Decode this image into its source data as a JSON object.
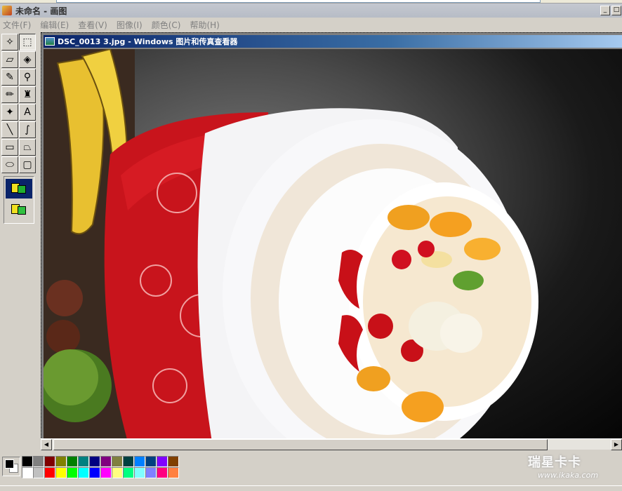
{
  "app": {
    "title": "未命名 - 画图",
    "minimize": "_",
    "maximize": "□"
  },
  "menu": [
    "文件(F)",
    "编辑(E)",
    "查看(V)",
    "图像(I)",
    "颜色(C)",
    "帮助(H)"
  ],
  "tools": [
    {
      "name": "free-form-select-icon",
      "glyph": "✧"
    },
    {
      "name": "select-rect-icon",
      "glyph": "⬚"
    },
    {
      "name": "eraser-icon",
      "glyph": "▱"
    },
    {
      "name": "fill-bucket-icon",
      "glyph": "◈"
    },
    {
      "name": "color-picker-icon",
      "glyph": "✎"
    },
    {
      "name": "magnifier-icon",
      "glyph": "⚲"
    },
    {
      "name": "pencil-icon",
      "glyph": "✏"
    },
    {
      "name": "brush-icon",
      "glyph": "♜"
    },
    {
      "name": "airbrush-icon",
      "glyph": "✦"
    },
    {
      "name": "text-icon",
      "glyph": "A"
    },
    {
      "name": "line-icon",
      "glyph": "╲"
    },
    {
      "name": "curve-icon",
      "glyph": "∫"
    },
    {
      "name": "rectangle-icon",
      "glyph": "▭"
    },
    {
      "name": "polygon-icon",
      "glyph": "⏢"
    },
    {
      "name": "ellipse-icon",
      "glyph": "⬭"
    },
    {
      "name": "rounded-rect-icon",
      "glyph": "▢"
    }
  ],
  "viewer": {
    "title": "DSC_0013 3.jpg - Windows 图片和传真查看器"
  },
  "palette": {
    "foreground": "#000000",
    "background": "#ffffff",
    "colors": [
      "#000000",
      "#808080",
      "#800000",
      "#808000",
      "#008000",
      "#008080",
      "#000080",
      "#800080",
      "#808040",
      "#004040",
      "#0080ff",
      "#004080",
      "#8000ff",
      "#804000",
      "#ffffff",
      "#c0c0c0",
      "#ff0000",
      "#ffff00",
      "#00ff00",
      "#00ffff",
      "#0000ff",
      "#ff00ff",
      "#ffff80",
      "#00ff80",
      "#80ffff",
      "#8080ff",
      "#ff0080",
      "#ff8040"
    ]
  },
  "watermark": {
    "brand": "瑞星卡卡",
    "url": "www.ikaka.com"
  }
}
